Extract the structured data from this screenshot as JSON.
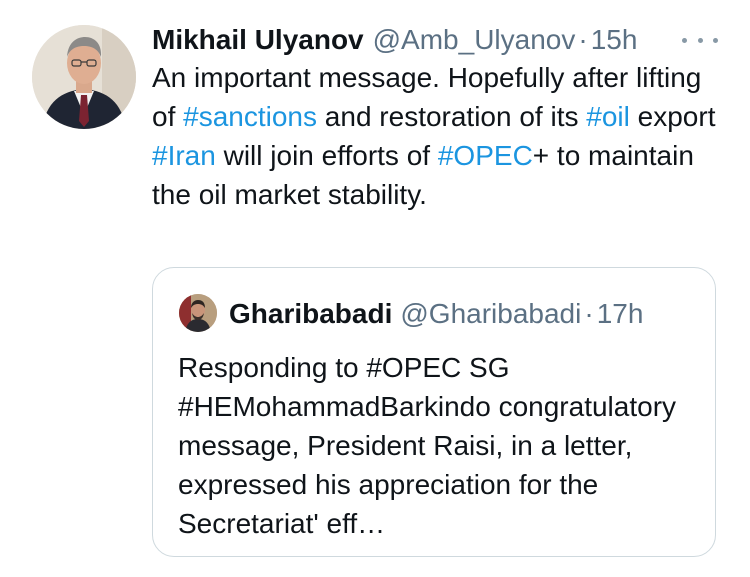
{
  "tweet": {
    "display_name": "Mikhail Ulyanov",
    "handle": "@Amb_Ulyanov",
    "separator": "·",
    "time": "15h",
    "text_parts": {
      "p1": "An important message. Hopefully after lifting of ",
      "tag1": "#sanctions",
      "p2": " and restoration of its ",
      "tag2": "#oil",
      "p3": " export ",
      "tag3": "#Iran",
      "p4": " will join efforts of ",
      "tag4": "#OPEC",
      "p5": "+ to maintain the oil market stability."
    }
  },
  "quoted": {
    "display_name": "Gharibabadi",
    "handle": "@Gharibabadi",
    "separator": "·",
    "time": "17h",
    "text": "Responding to #OPEC SG #HEMohammadBarkindo congratulatory message, President Raisi, in a letter, expressed his appreciation for the Secretariat' eff…"
  },
  "colors": {
    "text": "#0f1419",
    "secondary": "#5b7083",
    "hashtag": "#1b95e0",
    "border": "#cfd9de"
  },
  "icons": {
    "more": "more-horizontal-icon"
  }
}
